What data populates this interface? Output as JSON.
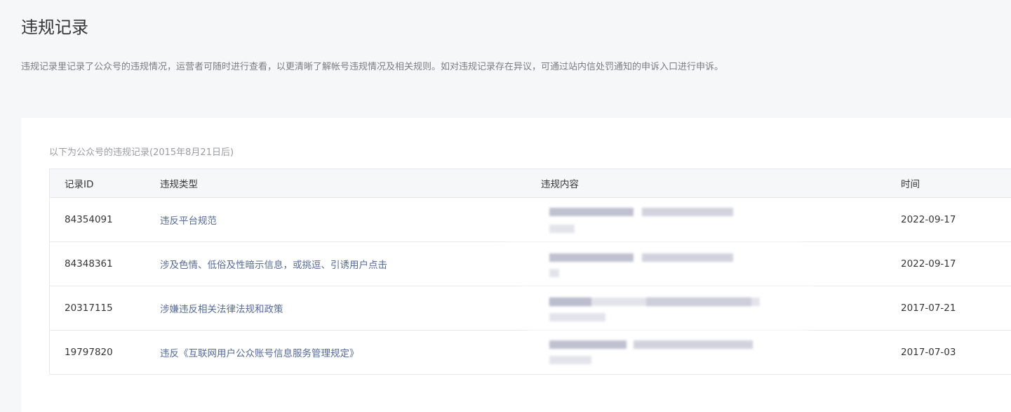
{
  "page": {
    "title": "违规记录",
    "description": "违规记录里记录了公众号的违规情况，运营者可随时进行查看，以更清晰了解帐号违规情况及相关规则。如对违规记录存在异议，可通过站内信处罚通知的申诉入口进行申诉。"
  },
  "table": {
    "caption": "以下为公众号的违规记录(2015年8月21日后)",
    "headers": {
      "id": "记录ID",
      "type": "违规类型",
      "content": "违规内容",
      "time": "时间"
    },
    "rows": [
      {
        "id": "84354091",
        "type": "违反平台规范",
        "time": "2022-09-17"
      },
      {
        "id": "84348361",
        "type": "涉及色情、低俗及性暗示信息，或挑逗、引诱用户点击",
        "time": "2022-09-17"
      },
      {
        "id": "20317115",
        "type": "涉嫌违反相关法律法规和政策",
        "time": "2017-07-21"
      },
      {
        "id": "19797820",
        "type": "违反《互联网用户公众账号信息服务管理规定》",
        "time": "2017-07-03"
      }
    ]
  },
  "colors": {
    "link": "#576b95",
    "background": "#f6f7f9",
    "border": "#e7e8eb"
  }
}
